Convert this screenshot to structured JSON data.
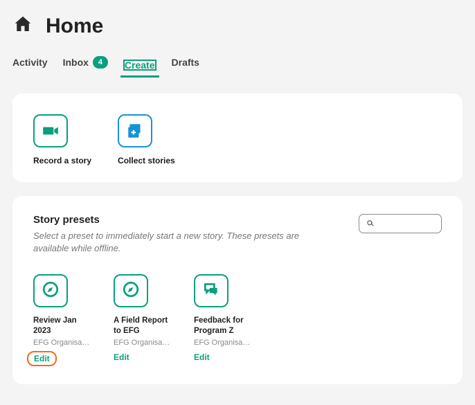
{
  "header": {
    "title": "Home"
  },
  "tabs": {
    "activity": "Activity",
    "inbox": "Inbox",
    "inbox_count": "4",
    "create": "Create",
    "drafts": "Drafts",
    "active": "create"
  },
  "actions": {
    "record": {
      "label": "Record a story"
    },
    "collect": {
      "label": "Collect stories"
    }
  },
  "presets_section": {
    "title": "Story presets",
    "subtitle": "Select a preset to immediately start a new story. These presets are available while offline.",
    "search_placeholder": ""
  },
  "presets": [
    {
      "title": "Review Jan 2023",
      "org": "EFG Organisa…",
      "edit": "Edit",
      "icon": "compass"
    },
    {
      "title": "A Field Report to EFG",
      "org": "EFG Organisa…",
      "edit": "Edit",
      "icon": "compass"
    },
    {
      "title": "Feedback for Program Z",
      "org": "EFG Organisa…",
      "edit": "Edit",
      "icon": "chat"
    }
  ],
  "colors": {
    "accent": "#0a9f7d",
    "blue": "#1693d6",
    "highlight": "#f36a1f"
  }
}
